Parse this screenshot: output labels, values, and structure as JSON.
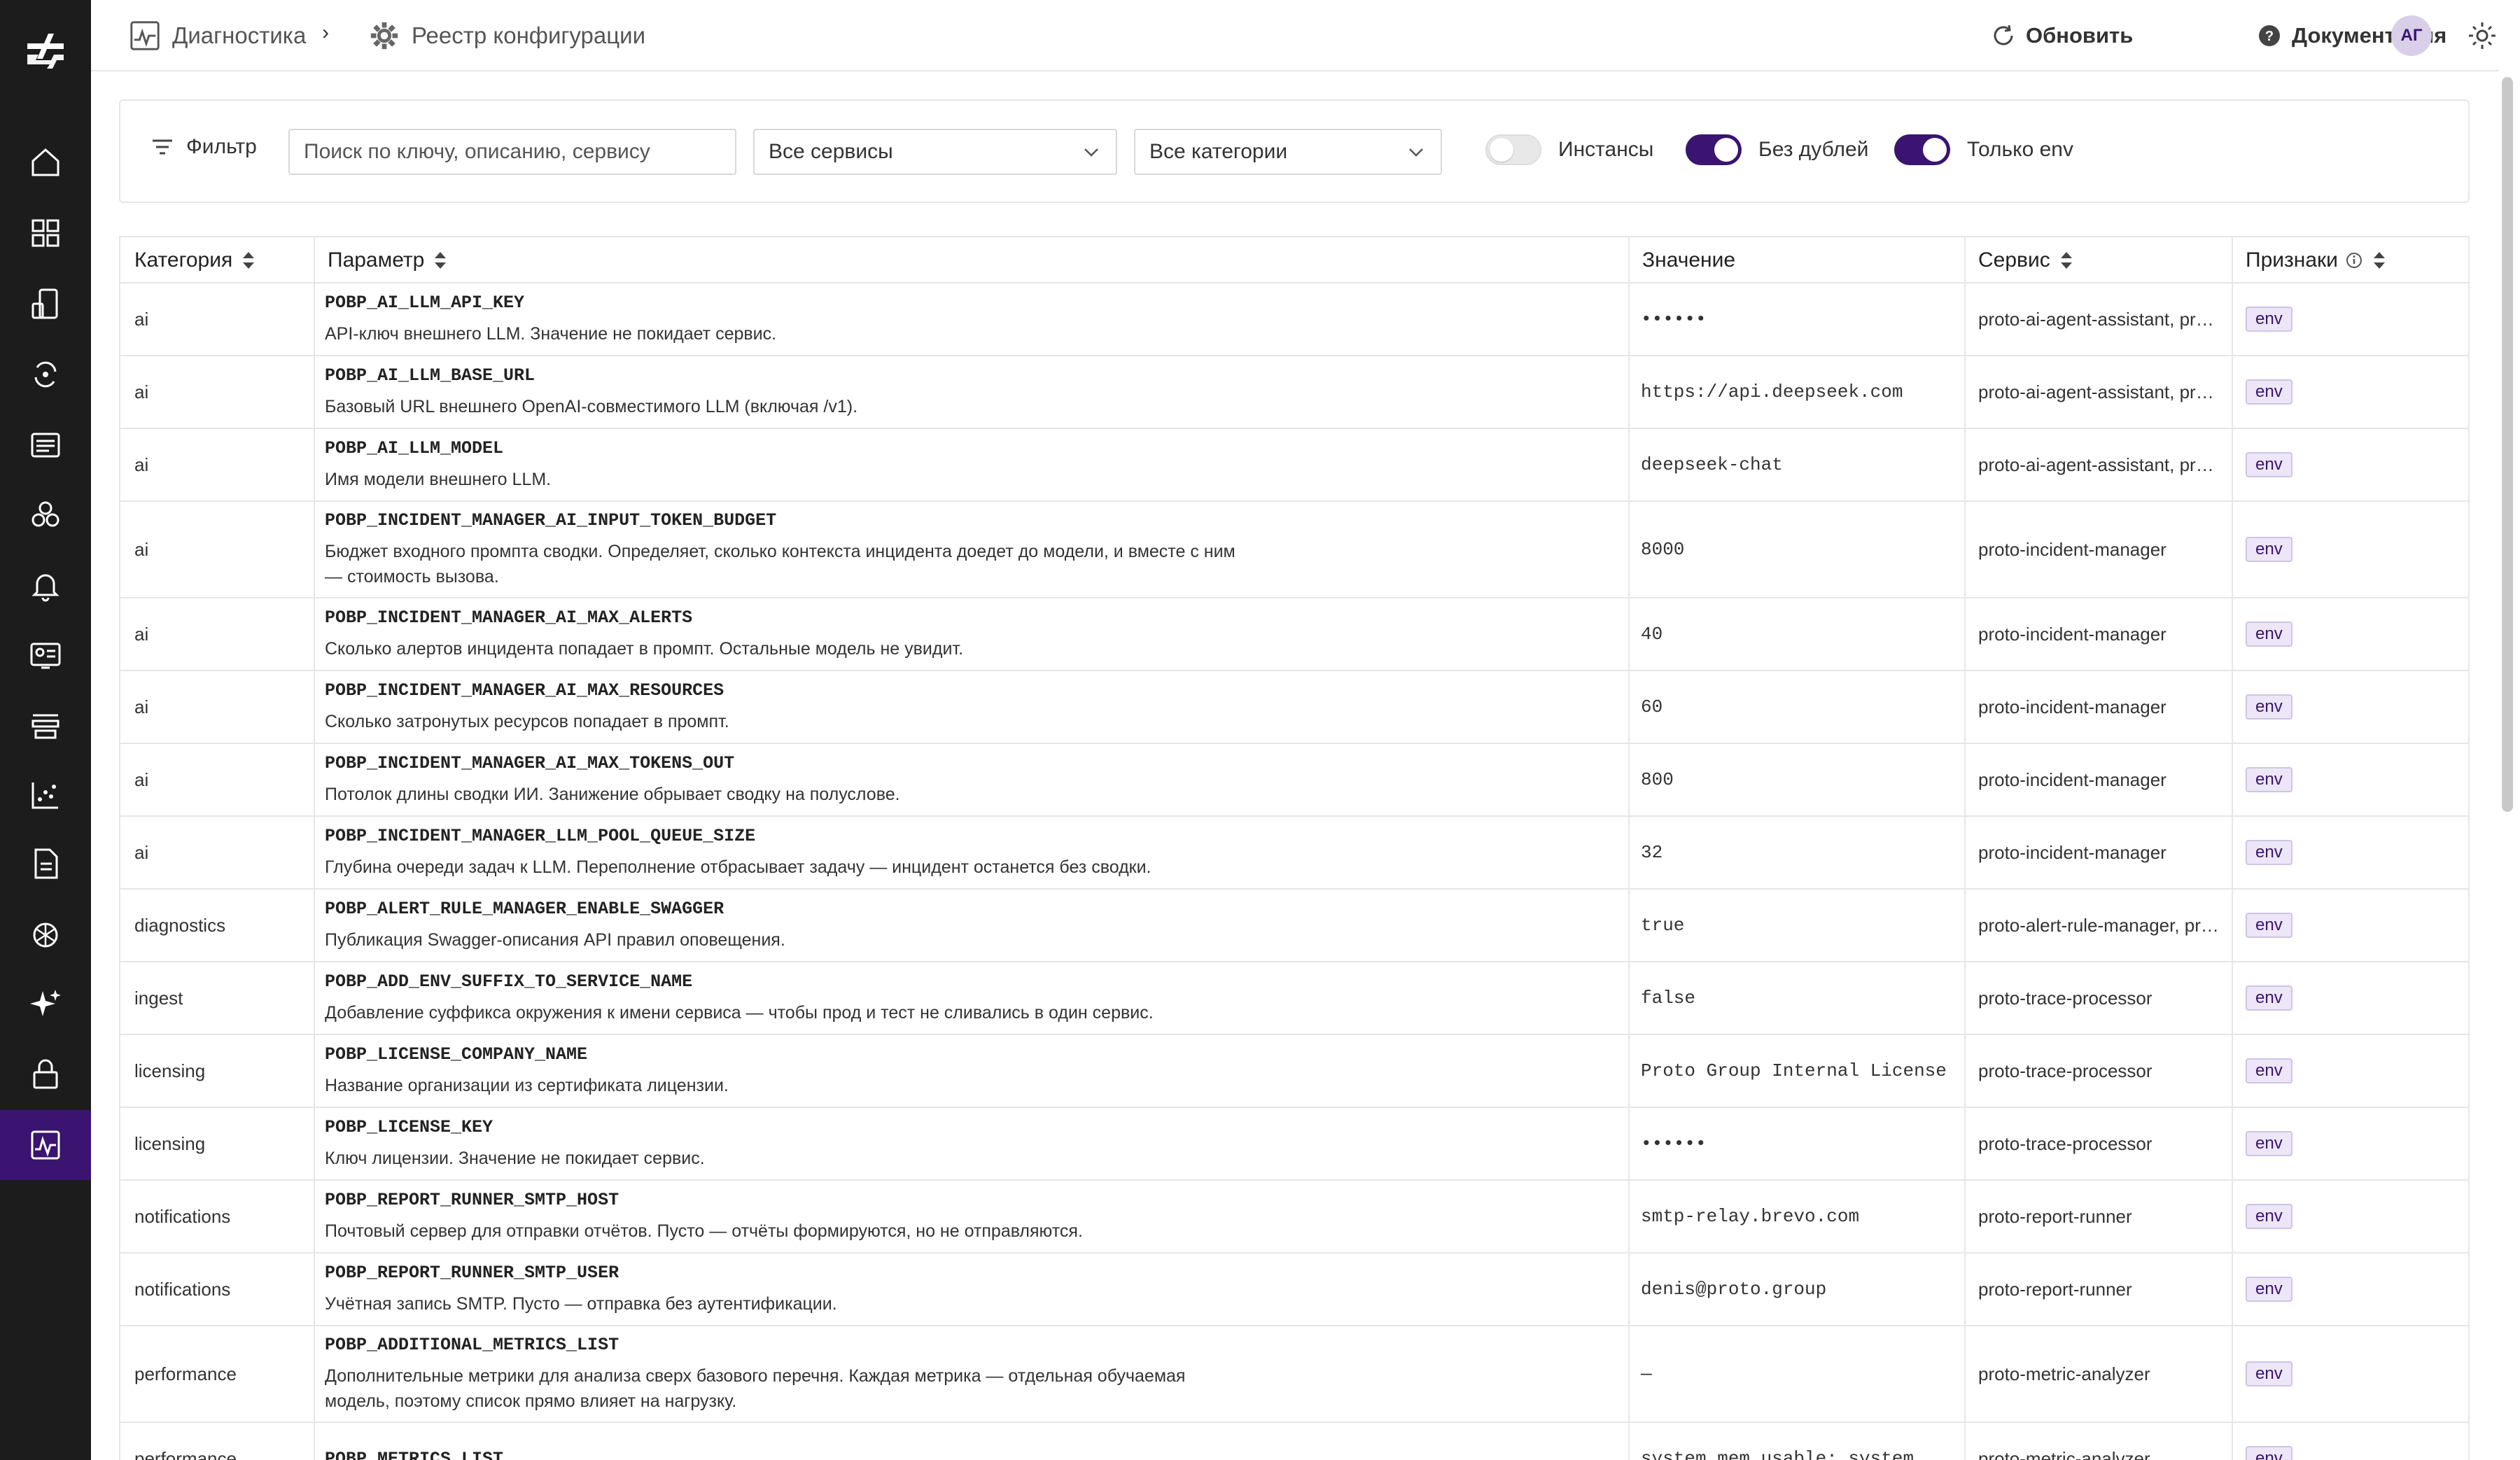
{
  "topbar": {
    "breadcrumb_root": "Диагностика",
    "breadcrumb_current": "Реестр конфигурации",
    "refresh_label": "Обновить",
    "docs_label": "Документация",
    "avatar_initials": "АГ"
  },
  "sidebar": {
    "items": [
      {
        "icon": "home-icon"
      },
      {
        "icon": "dashboard-grid-icon"
      },
      {
        "icon": "devices-icon"
      },
      {
        "icon": "sync-icon"
      },
      {
        "icon": "list-card-icon"
      },
      {
        "icon": "hexagons-icon"
      },
      {
        "icon": "bell-icon"
      },
      {
        "icon": "contact-card-icon"
      },
      {
        "icon": "layers-icon"
      },
      {
        "icon": "scatter-chart-icon"
      },
      {
        "icon": "document-icon"
      },
      {
        "icon": "brain-icon"
      },
      {
        "icon": "sparkle-icon"
      },
      {
        "icon": "lock-icon"
      },
      {
        "icon": "pulse-icon",
        "active": true
      }
    ]
  },
  "filters": {
    "label": "Фильтр",
    "search_placeholder": "Поиск по ключу, описанию, сервису",
    "services_select": "Все сервисы",
    "categories_select": "Все категории",
    "toggles": [
      {
        "label": "Инстансы",
        "on": false
      },
      {
        "label": "Без дублей",
        "on": true
      },
      {
        "label": "Только env",
        "on": true
      }
    ]
  },
  "table": {
    "columns": {
      "category": "Категория",
      "parameter": "Параметр",
      "value": "Значение",
      "service": "Сервис",
      "flags": "Признаки"
    },
    "rows": [
      {
        "category": "ai",
        "key": "POBP_AI_LLM_API_KEY",
        "desc": "API-ключ внешнего LLM. Значение не покидает сервис.",
        "value": "••••••",
        "service": "proto-ai-agent-assistant, proto-incident-manager",
        "flag": "env"
      },
      {
        "category": "ai",
        "key": "POBP_AI_LLM_BASE_URL",
        "desc": "Базовый URL внешнего OpenAI-совместимого LLM (включая /v1).",
        "value": "https://api.deepseek.com",
        "service": "proto-ai-agent-assistant, proto-incident-manager",
        "flag": "env"
      },
      {
        "category": "ai",
        "key": "POBP_AI_LLM_MODEL",
        "desc": "Имя модели внешнего LLM.",
        "value": "deepseek-chat",
        "service": "proto-ai-agent-assistant, proto-incident-manager",
        "flag": "env"
      },
      {
        "category": "ai",
        "key": "POBP_INCIDENT_MANAGER_AI_INPUT_TOKEN_BUDGET",
        "desc": "Бюджет входного промпта сводки. Определяет, сколько контекста инцидента доедет до модели, и вместе с ним — стоимость вызова.",
        "value": "8000",
        "service": "proto-incident-manager",
        "flag": "env"
      },
      {
        "category": "ai",
        "key": "POBP_INCIDENT_MANAGER_AI_MAX_ALERTS",
        "desc": "Сколько алертов инцидента попадает в промпт. Остальные модель не увидит.",
        "value": "40",
        "service": "proto-incident-manager",
        "flag": "env"
      },
      {
        "category": "ai",
        "key": "POBP_INCIDENT_MANAGER_AI_MAX_RESOURCES",
        "desc": "Сколько затронутых ресурсов попадает в промпт.",
        "value": "60",
        "service": "proto-incident-manager",
        "flag": "env"
      },
      {
        "category": "ai",
        "key": "POBP_INCIDENT_MANAGER_AI_MAX_TOKENS_OUT",
        "desc": "Потолок длины сводки ИИ. Занижение обрывает сводку на полуслове.",
        "value": "800",
        "service": "proto-incident-manager",
        "flag": "env"
      },
      {
        "category": "ai",
        "key": "POBP_INCIDENT_MANAGER_LLM_POOL_QUEUE_SIZE",
        "desc": "Глубина очереди задач к LLM. Переполнение отбрасывает задачу — инцидент останется без сводки.",
        "value": "32",
        "service": "proto-incident-manager",
        "flag": "env"
      },
      {
        "category": "diagnostics",
        "key": "POBP_ALERT_RULE_MANAGER_ENABLE_SWAGGER",
        "desc": "Публикация Swagger-описания API правил оповещения.",
        "value": "true",
        "service": "proto-alert-rule-manager, proto-report-runner",
        "flag": "env"
      },
      {
        "category": "ingest",
        "key": "POBP_ADD_ENV_SUFFIX_TO_SERVICE_NAME",
        "desc": "Добавление суффикса окружения к имени сервиса — чтобы прод и тест не сливались в один сервис.",
        "value": "false",
        "service": "proto-trace-processor",
        "flag": "env"
      },
      {
        "category": "licensing",
        "key": "POBP_LICENSE_COMPANY_NAME",
        "desc": "Название организации из сертификата лицензии.",
        "value": "Proto Group Internal License",
        "service": "proto-trace-processor",
        "flag": "env"
      },
      {
        "category": "licensing",
        "key": "POBP_LICENSE_KEY",
        "desc": "Ключ лицензии. Значение не покидает сервис.",
        "value": "••••••",
        "service": "proto-trace-processor",
        "flag": "env"
      },
      {
        "category": "notifications",
        "key": "POBP_REPORT_RUNNER_SMTP_HOST",
        "desc": "Почтовый сервер для отправки отчётов. Пусто — отчёты формируются, но не отправляются.",
        "value": "smtp-relay.brevo.com",
        "service": "proto-report-runner",
        "flag": "env"
      },
      {
        "category": "notifications",
        "key": "POBP_REPORT_RUNNER_SMTP_USER",
        "desc": "Учётная запись SMTP. Пусто — отправка без аутентификации.",
        "value": "denis@proto.group",
        "service": "proto-report-runner",
        "flag": "env"
      },
      {
        "category": "performance",
        "key": "POBP_ADDITIONAL_METRICS_LIST",
        "desc": "Дополнительные метрики для анализа сверх базового перечня. Каждая метрика — отдельная обучаемая модель, поэтому список прямо влияет на нагрузку.",
        "value": "—",
        "service": "proto-metric-analyzer",
        "flag": "env"
      },
      {
        "category": "performance",
        "key": "POBP_METRICS_LIST",
        "desc": "",
        "value": "system_mem_usable; system",
        "service": "proto-metric-analyzer",
        "flag": "env"
      }
    ]
  }
}
